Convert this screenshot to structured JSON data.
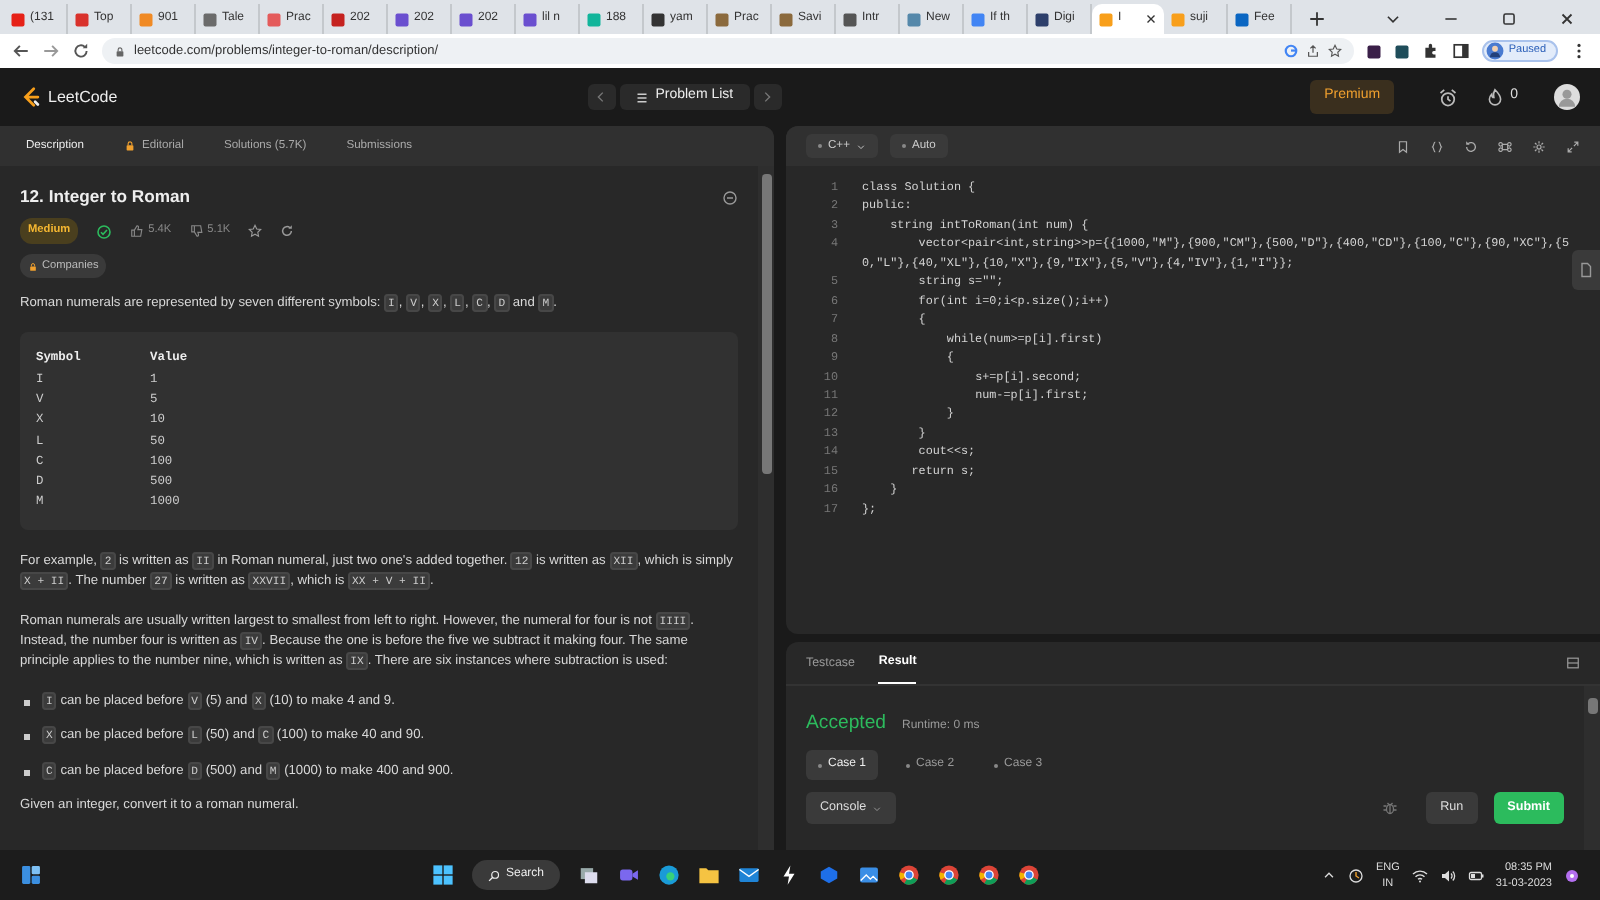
{
  "browser": {
    "tabs": [
      {
        "title": "(131",
        "selected": false
      },
      {
        "title": "Top",
        "selected": false
      },
      {
        "title": "901",
        "selected": false
      },
      {
        "title": "Tale",
        "selected": false
      },
      {
        "title": "Prac",
        "selected": false
      },
      {
        "title": "202",
        "selected": false
      },
      {
        "title": "202",
        "selected": false
      },
      {
        "title": "202",
        "selected": false
      },
      {
        "title": "lil n",
        "selected": false
      },
      {
        "title": "188",
        "selected": false
      },
      {
        "title": "yam",
        "selected": false
      },
      {
        "title": "Prac",
        "selected": false
      },
      {
        "title": "Savi",
        "selected": false
      },
      {
        "title": "Intr",
        "selected": false
      },
      {
        "title": "New",
        "selected": false
      },
      {
        "title": "If th",
        "selected": false
      },
      {
        "title": "Digi",
        "selected": false
      },
      {
        "title": "I",
        "selected": true
      },
      {
        "title": "suji",
        "selected": false
      },
      {
        "title": "Fee",
        "selected": false
      }
    ],
    "address": "leetcode.com/problems/integer-to-roman/description/",
    "profile_status": "Paused"
  },
  "header": {
    "logo": "LeetCode",
    "problem_list": "Problem List",
    "premium": "Premium",
    "streak": "0"
  },
  "panel_tabs": [
    {
      "label": "Description",
      "selected": true,
      "kind": "plain"
    },
    {
      "label": "Editorial",
      "selected": false,
      "kind": "locked"
    },
    {
      "label": "Solutions (5.7K)",
      "selected": false,
      "kind": "plain"
    },
    {
      "label": "Submissions",
      "selected": false,
      "kind": "plain"
    }
  ],
  "editor_toolbar": {
    "language": "C++",
    "mode": "Auto"
  },
  "problem": {
    "title": "12. Integer to Roman",
    "difficulty": "Medium",
    "solved": true,
    "likes": "5.4K",
    "dislikes": "5.1K",
    "companies": "Companies",
    "intro": [
      "Roman numerals are represented by seven different symbols: ",
      {
        "code": "I"
      },
      ", ",
      {
        "code": "V"
      },
      ", ",
      {
        "code": "X"
      },
      ", ",
      {
        "code": "L"
      },
      ", ",
      {
        "code": "C"
      },
      ", ",
      {
        "code": "D"
      },
      " and ",
      {
        "code": "M"
      },
      "."
    ],
    "symbol_table": {
      "columns": [
        "Symbol",
        "Value"
      ],
      "rows": [
        [
          "I",
          "1"
        ],
        [
          "V",
          "5"
        ],
        [
          "X",
          "10"
        ],
        [
          "L",
          "50"
        ],
        [
          "C",
          "100"
        ],
        [
          "D",
          "500"
        ],
        [
          "M",
          "1000"
        ]
      ]
    },
    "paragraphs": [
      [
        "For example, ",
        {
          "code": "2"
        },
        " is written as ",
        {
          "code": "II"
        },
        " in Roman numeral, just two one's added together. ",
        {
          "code": "12"
        },
        " is written as ",
        {
          "code": "XII"
        },
        ", which is simply ",
        {
          "code": "X + II"
        },
        ". The number ",
        {
          "code": "27"
        },
        " is written as ",
        {
          "code": "XXVII"
        },
        ", which is ",
        {
          "code": "XX + V + II"
        },
        "."
      ],
      [
        "Roman numerals are usually written largest to smallest from left to right. However, the numeral for four is not ",
        {
          "code": "IIII"
        },
        ". Instead, the number four is written as ",
        {
          "code": "IV"
        },
        ". Because the one is before the five we subtract it making four. The same principle applies to the number nine, which is written as ",
        {
          "code": "IX"
        },
        ". There are six instances where subtraction is used:"
      ]
    ],
    "bullets": [
      [
        {
          "code": "I"
        },
        " can be placed before ",
        {
          "code": "V"
        },
        " (5) and ",
        {
          "code": "X"
        },
        " (10) to make 4 and 9."
      ],
      [
        {
          "code": "X"
        },
        " can be placed before ",
        {
          "code": "L"
        },
        " (50) and ",
        {
          "code": "C"
        },
        " (100) to make 40 and 90."
      ],
      [
        {
          "code": "C"
        },
        " can be placed before ",
        {
          "code": "D"
        },
        " (500) and ",
        {
          "code": "M"
        },
        " (1000) to make 400 and 900."
      ]
    ],
    "closing": "Given an integer, convert it to a roman numeral."
  },
  "code": {
    "lines": [
      {
        "number": "1",
        "text": "class Solution {"
      },
      {
        "number": "2",
        "text": "public:"
      },
      {
        "number": "3",
        "text": "    string intToRoman(int num) {"
      },
      {
        "number": "4",
        "text": "        vector<pair<int,string>>p={{1000,\"M\"},{900,\"CM\"},{500,\"D\"},{400,\"CD\"},{100,\"C\"},{90,\"XC\"},{50,\"L\"},{40,\"XL\"},{10,\"X\"},{9,\"IX\"},{5,\"V\"},{4,\"IV\"},{1,\"I\"}};"
      },
      {
        "number": "5",
        "text": "        string s=\"\";"
      },
      {
        "number": "6",
        "text": "        for(int i=0;i<p.size();i++)"
      },
      {
        "number": "7",
        "text": "        {"
      },
      {
        "number": "8",
        "text": "            while(num>=p[i].first)"
      },
      {
        "number": "9",
        "text": "            {"
      },
      {
        "number": "10",
        "text": "                s+=p[i].second;"
      },
      {
        "number": "11",
        "text": "                num-=p[i].first;"
      },
      {
        "number": "12",
        "text": "            }"
      },
      {
        "number": "13",
        "text": "        }"
      },
      {
        "number": "14",
        "text": "        cout<<s;"
      },
      {
        "number": "15",
        "text": "       return s;"
      },
      {
        "number": "16",
        "text": "    }"
      },
      {
        "number": "17",
        "text": "};"
      }
    ]
  },
  "result": {
    "tabs": [
      {
        "label": "Testcase",
        "selected": false
      },
      {
        "label": "Result",
        "selected": true
      }
    ],
    "status": "Accepted",
    "runtime": "Runtime: 0 ms",
    "cases": [
      {
        "label": "Case 1",
        "selected": true
      },
      {
        "label": "Case 2",
        "selected": false
      },
      {
        "label": "Case 3",
        "selected": false
      }
    ],
    "console": "Console",
    "run": "Run",
    "submit": "Submit"
  },
  "taskbar": {
    "search": "Search",
    "language": "ENG",
    "region": "IN",
    "time": "08:35 PM",
    "date": "31-03-2023"
  }
}
